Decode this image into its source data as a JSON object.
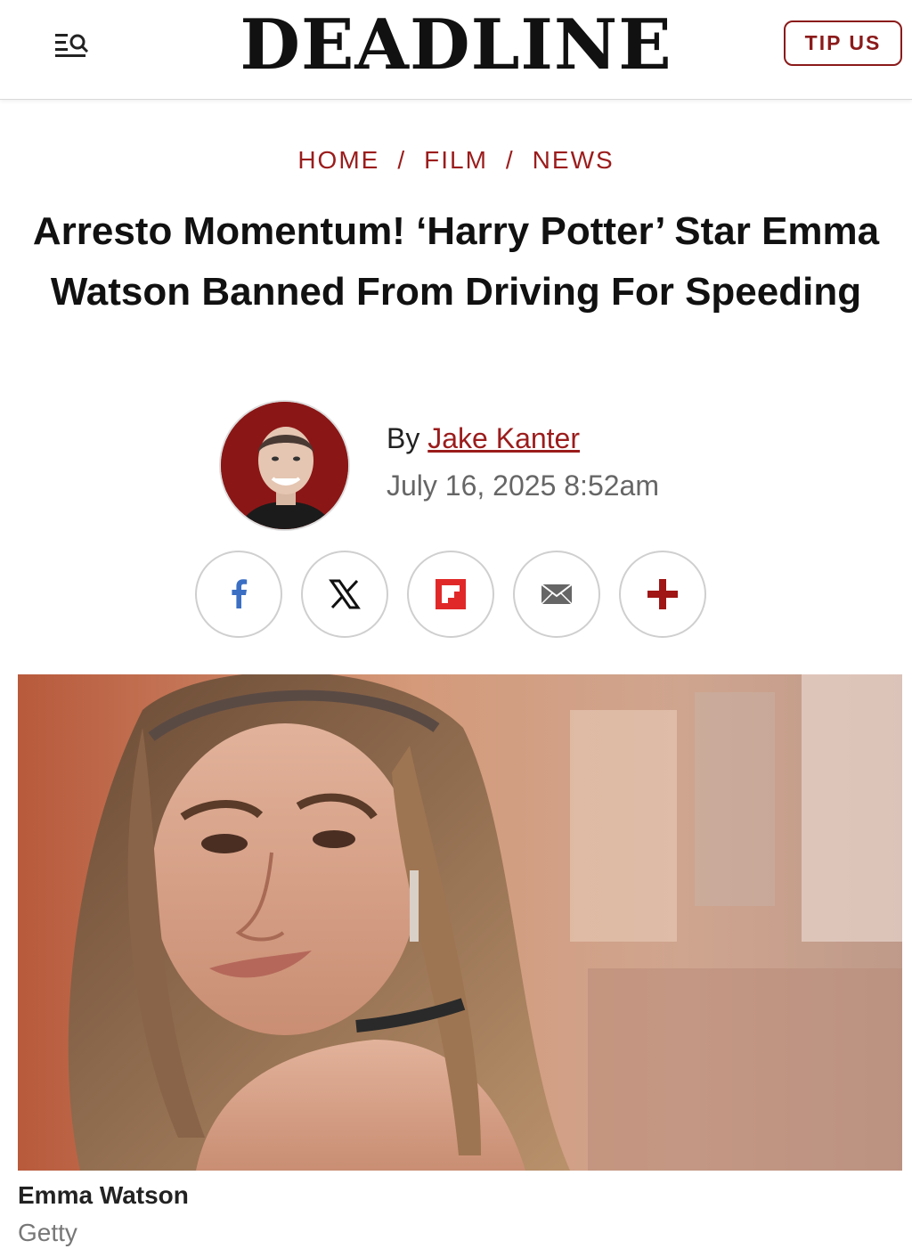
{
  "header": {
    "logo": "DEADLINE",
    "tip_label": "TIP US",
    "menu_icon": "menu-search-icon"
  },
  "breadcrumb": {
    "items": [
      "HOME",
      "FILM",
      "NEWS"
    ],
    "separator": "/"
  },
  "article": {
    "headline": "Arresto Momentum! ‘Harry Potter’ Star Emma Watson Banned From Driving For Speeding",
    "byline_prefix": "By",
    "author": "Jake Kanter",
    "date": "July 16, 2025 8:52am"
  },
  "share": {
    "buttons": [
      {
        "icon": "facebook-icon"
      },
      {
        "icon": "x-icon"
      },
      {
        "icon": "flipboard-icon"
      },
      {
        "icon": "email-icon"
      },
      {
        "icon": "plus-icon"
      }
    ]
  },
  "image": {
    "caption": "Emma Watson",
    "credit": "Getty"
  },
  "colors": {
    "brand_red": "#9b1c1c",
    "facebook_blue": "#3b6fc4",
    "flipboard_red": "#e12828"
  }
}
